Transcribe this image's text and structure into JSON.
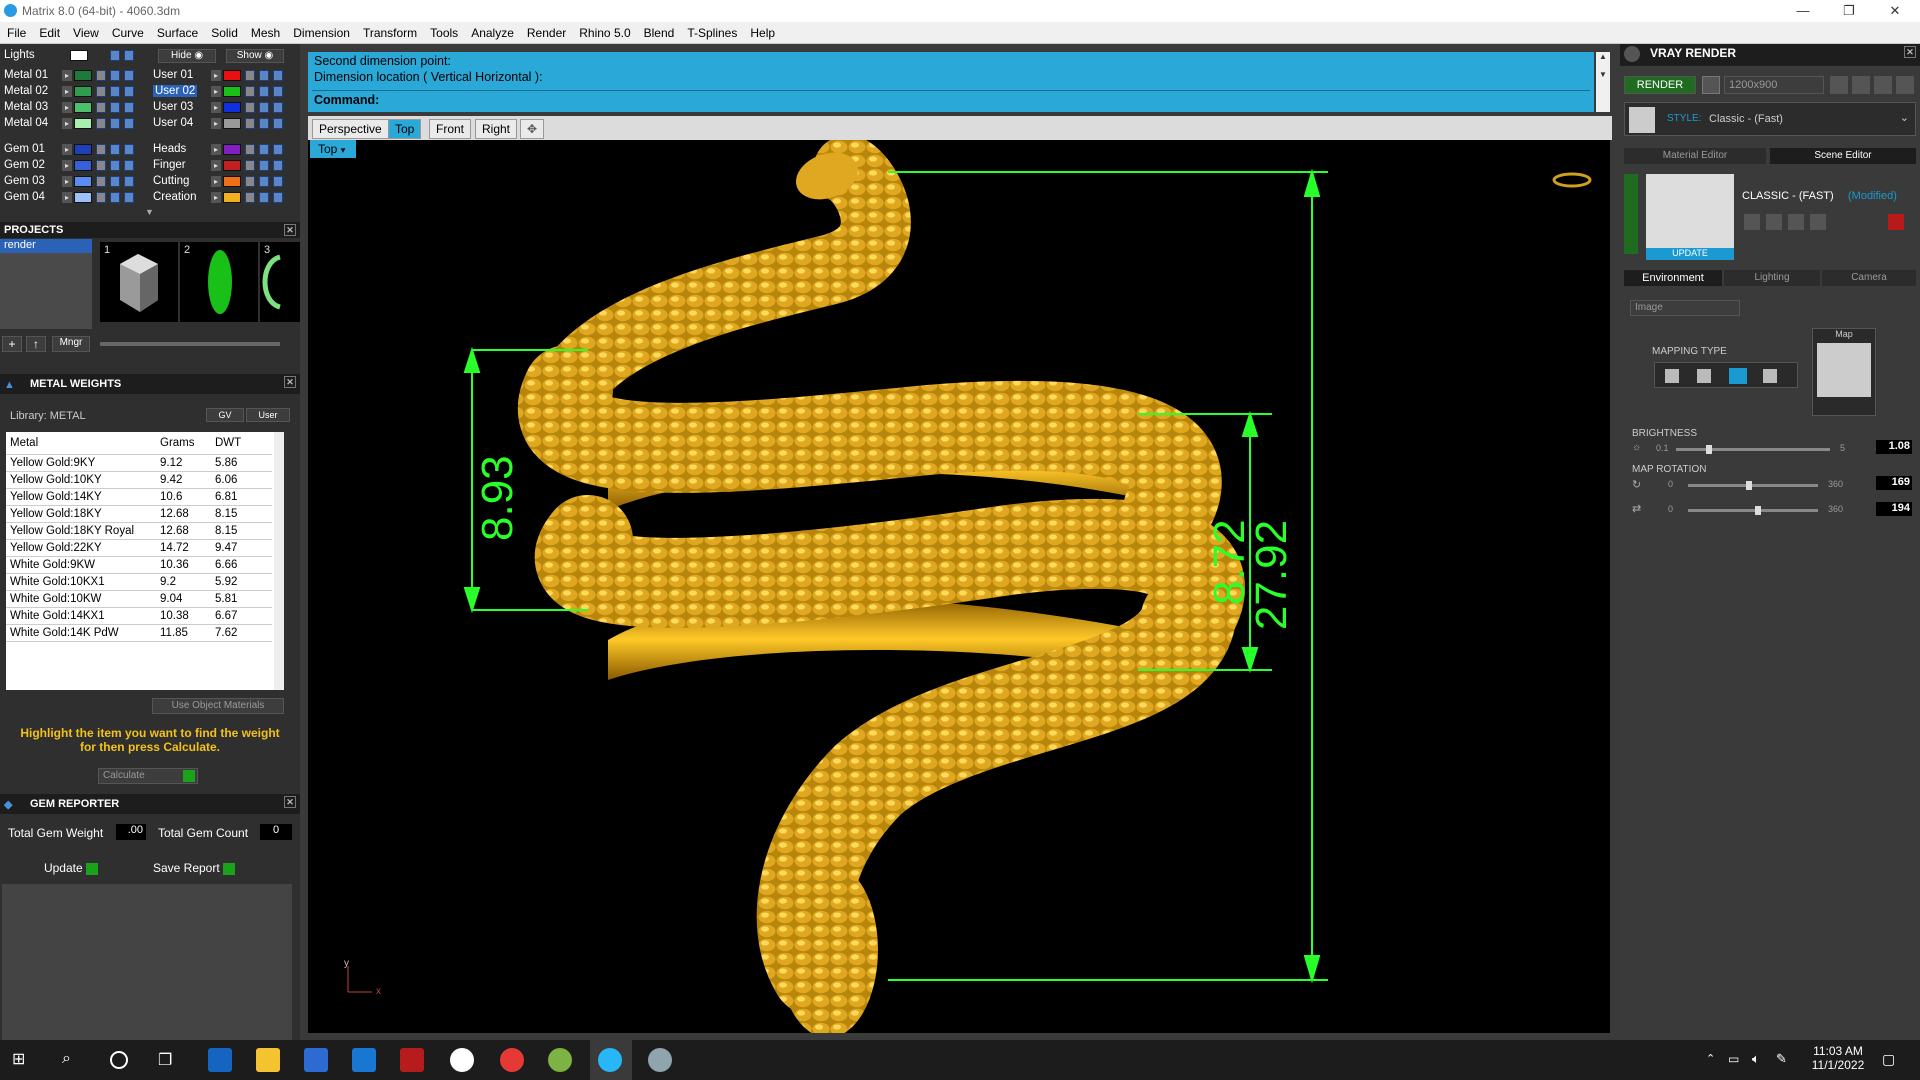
{
  "window": {
    "title": "Matrix 8.0 (64-bit) - 4060.3dm",
    "min": "—",
    "max": "❐",
    "close": "✕"
  },
  "menu": [
    "File",
    "Edit",
    "View",
    "Curve",
    "Surface",
    "Solid",
    "Mesh",
    "Dimension",
    "Transform",
    "Tools",
    "Analyze",
    "Render",
    "Rhino 5.0",
    "Blend",
    "T-Splines",
    "Help"
  ],
  "layers": {
    "lights_label": "Lights",
    "hide_label": "Hide",
    "show_label": "Show",
    "left": [
      {
        "name": "Metal 01",
        "color": "#1d7a3a"
      },
      {
        "name": "Metal 02",
        "color": "#2f9c4f"
      },
      {
        "name": "Metal 03",
        "color": "#4cc06a"
      },
      {
        "name": "Metal 04",
        "color": "#a8f0b0"
      },
      {
        "name": "Gem 01",
        "color": "#1e3fb8"
      },
      {
        "name": "Gem 02",
        "color": "#3560d8"
      },
      {
        "name": "Gem 03",
        "color": "#5b8df0"
      },
      {
        "name": "Gem 04",
        "color": "#9dc0f8"
      }
    ],
    "right": [
      {
        "name": "User 01",
        "color": "#e81010"
      },
      {
        "name": "User 02",
        "color": "#18c018",
        "selected": true
      },
      {
        "name": "User 03",
        "color": "#1030e0"
      },
      {
        "name": "User 04",
        "color": "#999999"
      },
      {
        "name": "Heads",
        "color": "#8020c0"
      },
      {
        "name": "Finger",
        "color": "#c02020"
      },
      {
        "name": "Cutting",
        "color": "#f07018"
      },
      {
        "name": "Creation",
        "color": "#f0b020"
      }
    ]
  },
  "projects": {
    "title": "PROJECTS",
    "items": [
      "render"
    ],
    "thumbs": [
      "1",
      "2",
      "3"
    ],
    "mngr": "Mngr"
  },
  "metal_weights": {
    "title": "METAL WEIGHTS",
    "library": "Library: METAL",
    "gv": "GV",
    "user": "User",
    "columns": [
      "Metal",
      "Grams",
      "DWT"
    ],
    "rows": [
      [
        "Yellow Gold:9KY",
        "9.12",
        "5.86"
      ],
      [
        "Yellow Gold:10KY",
        "9.42",
        "6.06"
      ],
      [
        "Yellow Gold:14KY",
        "10.6",
        "6.81"
      ],
      [
        "Yellow Gold:18KY",
        "12.68",
        "8.15"
      ],
      [
        "Yellow Gold:18KY Royal",
        "12.68",
        "8.15"
      ],
      [
        "Yellow Gold:22KY",
        "14.72",
        "9.47"
      ],
      [
        "White Gold:9KW",
        "10.36",
        "6.66"
      ],
      [
        "White Gold:10KX1",
        "9.2",
        "5.92"
      ],
      [
        "White Gold:10KW",
        "9.04",
        "5.81"
      ],
      [
        "White Gold:14KX1",
        "10.38",
        "6.67"
      ],
      [
        "White Gold:14K PdW",
        "11.85",
        "7.62"
      ]
    ],
    "use_object_materials": "Use Object Materials",
    "hint": "Highlight the item you want to find the weight for then press Calculate.",
    "calculate": "Calculate"
  },
  "gem_reporter": {
    "title": "GEM REPORTER",
    "total_weight_label": "Total Gem Weight",
    "total_weight": ".00",
    "total_count_label": "Total Gem Count",
    "total_count": "0",
    "update": "Update",
    "save_report": "Save Report"
  },
  "command": {
    "line1": "Second dimension point:",
    "line2": "Dimension location ( Vertical  Horizontal ):",
    "prompt": "Command:"
  },
  "viewtabs": [
    "Perspective",
    "Top",
    "Front",
    "Right"
  ],
  "active_view": "Top",
  "viewport_label": "Top",
  "dimensions": {
    "d1": "8.93",
    "d2": "8.72",
    "d3": "27.92"
  },
  "axes": {
    "y": "y",
    "x": "x"
  },
  "vray": {
    "title": "VRAY RENDER",
    "render": "RENDER",
    "resolution": "1200x900",
    "style_label": "STYLE:",
    "style_value": "Classic - (Fast)",
    "tab_material": "Material Editor",
    "tab_scene": "Scene Editor",
    "scene_name": "CLASSIC - (FAST)",
    "modified": "(Modified)",
    "update": "UPDATE",
    "subtabs": [
      "Environment",
      "Lighting",
      "Camera"
    ],
    "env_type": "Image",
    "mapping_type": "MAPPING TYPE",
    "map_label": "Map",
    "brightness_label": "BRIGHTNESS",
    "brightness_min": "0.1",
    "brightness_max": "5",
    "brightness": "1.08",
    "map_rotation_label": "MAP ROTATION",
    "rot_min": "0",
    "rot_max": "360",
    "rot1": "169",
    "rot2": "194"
  },
  "taskbar": {
    "time": "11:03 AM",
    "date": "11/1/2022"
  }
}
